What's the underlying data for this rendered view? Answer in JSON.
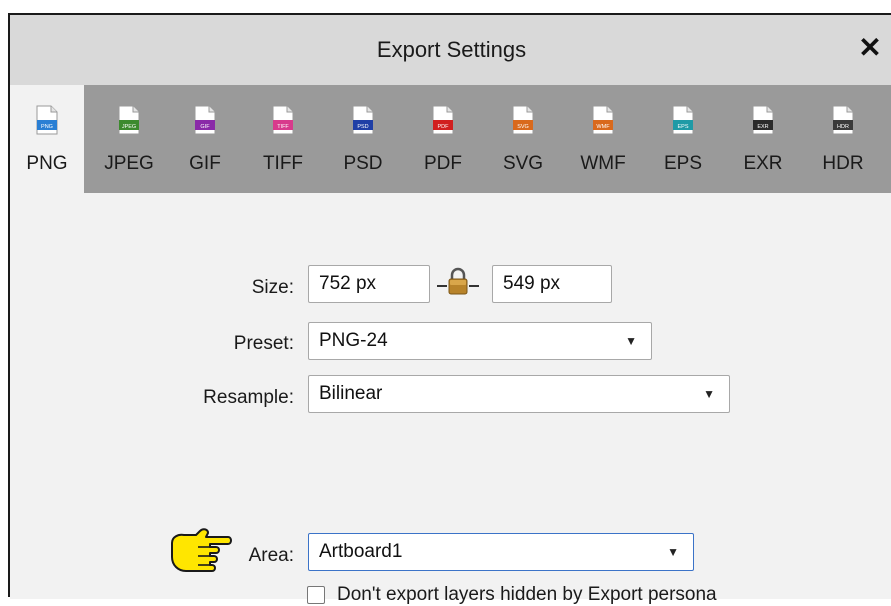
{
  "dialog": {
    "title": "Export Settings",
    "close_label": "✕"
  },
  "formats": [
    {
      "label": "PNG",
      "badge": "PNG",
      "color": "#2a7fd4",
      "active": true
    },
    {
      "label": "JPEG",
      "badge": "JPEG",
      "color": "#3c8a2e"
    },
    {
      "label": "GIF",
      "badge": "GIF",
      "color": "#8a2aa8"
    },
    {
      "label": "TIFF",
      "badge": "TIFF",
      "color": "#d83a8c"
    },
    {
      "label": "PSD",
      "badge": "PSD",
      "color": "#1f3fa6"
    },
    {
      "label": "PDF",
      "badge": "PDF",
      "color": "#d11f1f"
    },
    {
      "label": "SVG",
      "badge": "SVG",
      "color": "#d9691c"
    },
    {
      "label": "WMF",
      "badge": "WMF",
      "color": "#d9691c"
    },
    {
      "label": "EPS",
      "badge": "EPS",
      "color": "#1f9aa6"
    },
    {
      "label": "EXR",
      "badge": "EXR",
      "color": "#2b2b2b"
    },
    {
      "label": "HDR",
      "badge": "HDR",
      "color": "#3a3a3a"
    }
  ],
  "settings": {
    "size_label": "Size:",
    "width_value": "752 px",
    "height_value": "549 px",
    "preset_label": "Preset:",
    "preset_value": "PNG-24",
    "resample_label": "Resample:",
    "resample_value": "Bilinear",
    "area_label": "Area:",
    "area_value": "Artboard1",
    "checkbox_label": "Don't export layers hidden by Export persona",
    "checkbox_checked": false
  },
  "icons": {
    "dropdown": "chevron-down-icon",
    "lock": "lock-icon",
    "pointer": "pointing-hand-icon"
  }
}
